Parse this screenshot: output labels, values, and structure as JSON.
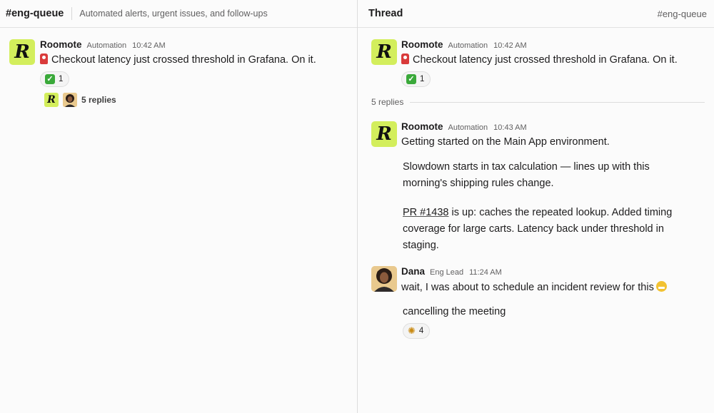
{
  "channel": {
    "name": "#eng-queue",
    "topic": "Automated alerts, urgent issues, and follow-ups",
    "message": {
      "author": "Roomote",
      "role": "Automation",
      "time": "10:42 AM",
      "text": "Checkout latency just crossed threshold in Grafana. On it.",
      "reaction": {
        "icon": "check-mark-icon",
        "count": "1"
      },
      "replies_label": "5 replies"
    }
  },
  "thread": {
    "title": "Thread",
    "channel": "#eng-queue",
    "parent": {
      "author": "Roomote",
      "role": "Automation",
      "time": "10:42 AM",
      "text": "Checkout latency just crossed threshold in Grafana. On it.",
      "reaction": {
        "icon": "check-mark-icon",
        "count": "1"
      }
    },
    "replies_divider": "5 replies",
    "replies": [
      {
        "author": "Roomote",
        "role": "Automation",
        "time": "10:43 AM",
        "lines": [
          "Getting started on the Main App environment.",
          "Slowdown starts in tax calculation — lines up with this morning's shipping rules change.",
          "is up: caches the repeated lookup. Added timing coverage for large carts. Latency back under threshold in staging."
        ],
        "link": "PR #1438"
      },
      {
        "author": "Dana",
        "role": "Eng Lead",
        "time": "11:24 AM",
        "lines": [
          "wait, I was about to schedule an incident review for this",
          "cancelling the meeting"
        ],
        "reaction": {
          "icon": "party-popper-icon",
          "count": "4"
        }
      }
    ]
  },
  "colors": {
    "avatar_bg": "#d3ee5c",
    "background": "#fbfbfb",
    "reaction_bg": "#f4f4f4"
  }
}
